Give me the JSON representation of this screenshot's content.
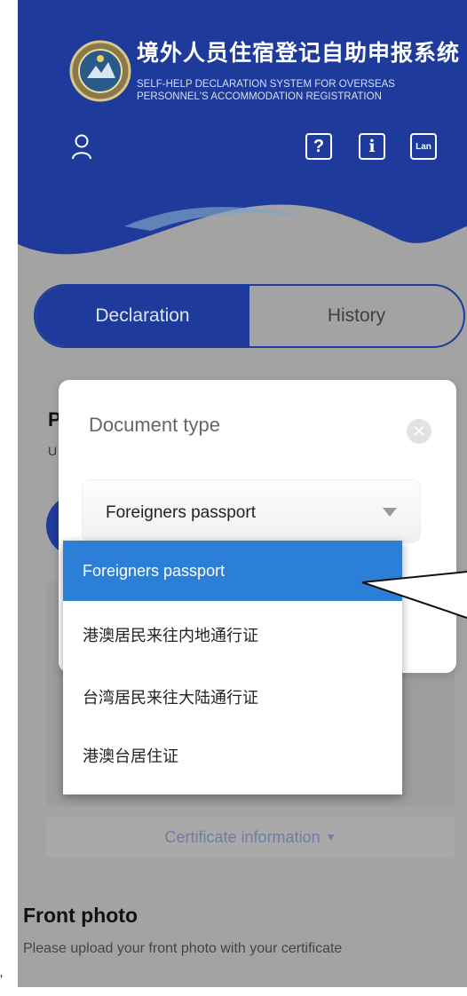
{
  "header": {
    "title_cn": "境外人员住宿登记自助申报系统",
    "title_en_line1": "SELF-HELP DECLARATION SYSTEM FOR OVERSEAS",
    "title_en_line2": "PERSONNEL'S ACCOMMODATION REGISTRATION",
    "help_label": "?",
    "info_label": "i",
    "language_label": "Lan",
    "brand_color": "#1e3b9b"
  },
  "tabs": [
    {
      "label": "Declaration",
      "active": true
    },
    {
      "label": "History",
      "active": false
    }
  ],
  "background": {
    "section_letter": "P",
    "section_sub_letter": "U",
    "certificate_info_label": "Certificate information",
    "front_photo_title": "Front photo",
    "front_photo_hint": "Please upload your front photo with your certificate"
  },
  "dialog": {
    "title": "Document type",
    "close_icon": "close-icon",
    "selected_value": "Foreigners passport",
    "options": [
      {
        "label": "Foreigners passport",
        "selected": true
      },
      {
        "label": "港澳居民来往内地通行证",
        "selected": false
      },
      {
        "label": "台湾居民来往大陆通行证",
        "selected": false
      },
      {
        "label": "港澳台居住证",
        "selected": false
      }
    ],
    "highlight_color": "#2b7fd6"
  }
}
